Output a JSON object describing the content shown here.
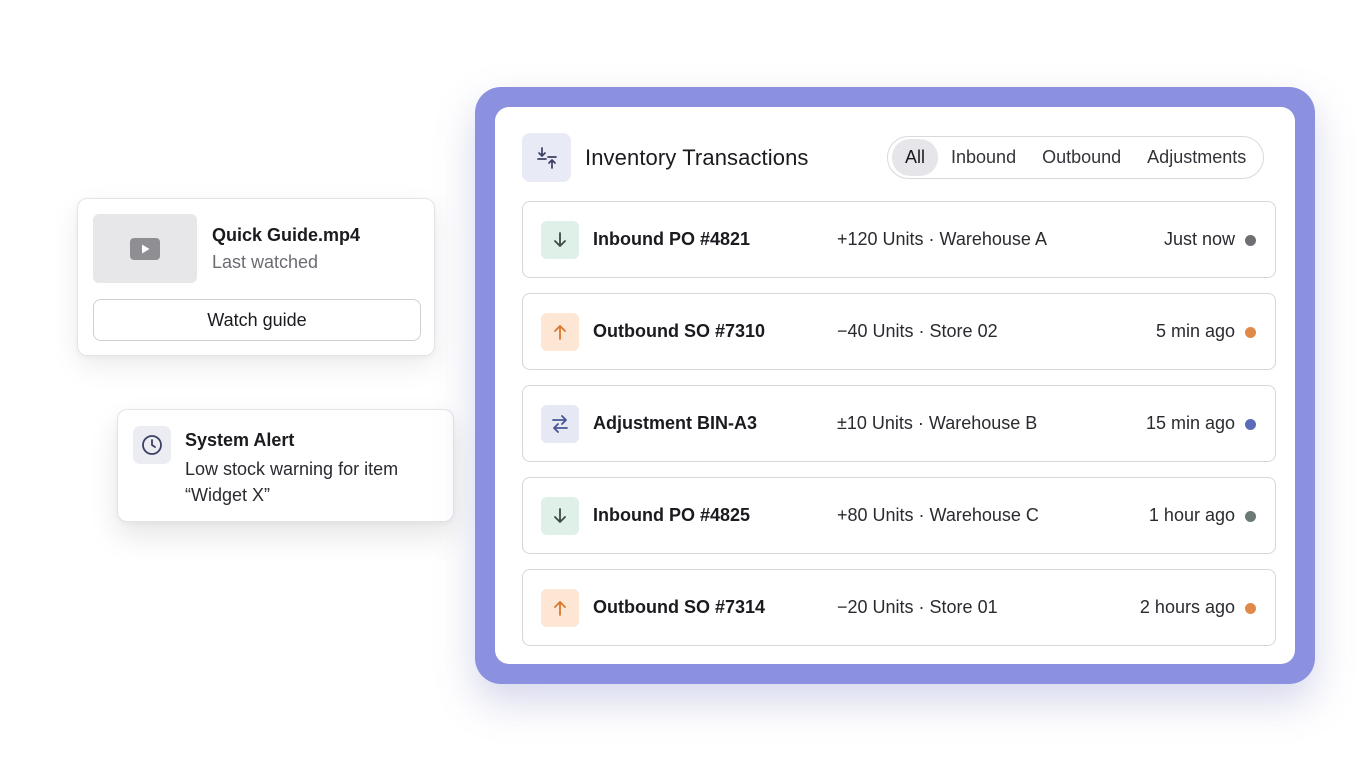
{
  "guide": {
    "title": "Quick Guide.mp4",
    "subtitle": "Last watched",
    "button_label": "Watch guide",
    "thumbnail_icon": "play-icon"
  },
  "alert": {
    "title": "System Alert",
    "message": "Low stock warning for item “Widget X”",
    "icon": "clock-icon"
  },
  "transactions": {
    "title": "Inventory Transactions",
    "header_icon": "transfer-arrows-icon",
    "frame_color": "#8b91de",
    "tabs": [
      {
        "label": "All",
        "active": true
      },
      {
        "label": "Inbound",
        "active": false
      },
      {
        "label": "Outbound",
        "active": false
      },
      {
        "label": "Adjustments",
        "active": false
      }
    ],
    "rows": [
      {
        "type": "inbound",
        "icon": "arrow-down-icon",
        "name": "Inbound PO #4821",
        "qty": "+120 Units · Warehouse A",
        "time": "Just now",
        "dot_color": "#6e6e73"
      },
      {
        "type": "outbound",
        "icon": "arrow-up-icon",
        "name": "Outbound SO #7310",
        "qty": "−40 Units · Store 02",
        "time": "5 min ago",
        "dot_color": "#e08a4a"
      },
      {
        "type": "adjustment",
        "icon": "swap-arrows-icon",
        "name": "Adjustment BIN-A3",
        "qty": "±10 Units · Warehouse B",
        "time": "15 min ago",
        "dot_color": "#5a6bb8"
      },
      {
        "type": "inbound",
        "icon": "arrow-down-icon",
        "name": "Inbound PO #4825",
        "qty": "+80 Units · Warehouse C",
        "time": "1 hour ago",
        "dot_color": "#6b7a72"
      },
      {
        "type": "outbound",
        "icon": "arrow-up-icon",
        "name": "Outbound SO #7314",
        "qty": "−20 Units · Store 01",
        "time": "2 hours ago",
        "dot_color": "#e08a4a"
      }
    ]
  }
}
